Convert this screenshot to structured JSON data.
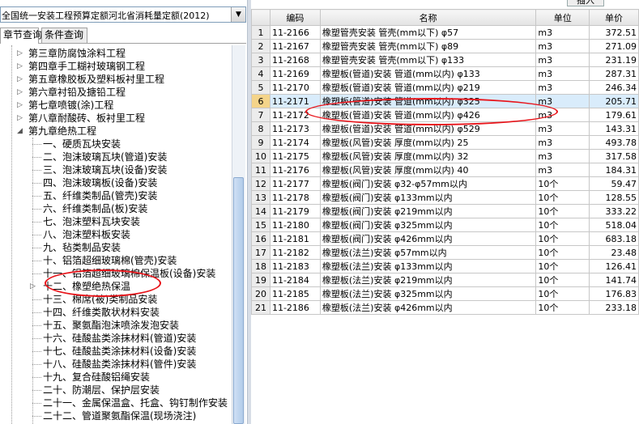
{
  "library_select": {
    "value": "全国统一安装工程预算定额河北省消耗量定额(2012)"
  },
  "tabs": [
    {
      "label": "章节查询"
    },
    {
      "label": "条件查询"
    }
  ],
  "tree": {
    "chapters": [
      {
        "label": "第三章防腐蚀涂料工程"
      },
      {
        "label": "第四章手工糊衬玻璃钢工程"
      },
      {
        "label": "第五章橡胶板及塑料板衬里工程"
      },
      {
        "label": "第六章衬铅及搪铅工程"
      },
      {
        "label": "第七章喷镀(涂)工程"
      },
      {
        "label": "第八章耐酸砖、板衬里工程"
      },
      {
        "label": "第九章绝热工程"
      }
    ],
    "sections": [
      {
        "label": "一、硬质瓦块安装"
      },
      {
        "label": "二、泡沫玻璃瓦块(管道)安装"
      },
      {
        "label": "三、泡沫玻璃瓦块(设备)安装"
      },
      {
        "label": "四、泡沫玻璃板(设备)安装"
      },
      {
        "label": "五、纤维类制品(管壳)安装"
      },
      {
        "label": "六、纤维类制品(板)安装"
      },
      {
        "label": "七、泡沫塑料瓦块安装"
      },
      {
        "label": "八、泡沫塑料板安装"
      },
      {
        "label": "九、毡类制品安装"
      },
      {
        "label": "十、铝箔超细玻璃棉(管壳)安装"
      },
      {
        "label": "十一、铝箔超细玻璃棉保温板(设备)安装"
      },
      {
        "label": "十二、橡塑绝热保温"
      },
      {
        "label": "十三、棉席(被)类制品安装"
      },
      {
        "label": "十四、纤维类散状材料安装"
      },
      {
        "label": "十五、聚氨酯泡沫喷涂发泡安装"
      },
      {
        "label": "十六、硅酸盐类涂抹材料(管道)安装"
      },
      {
        "label": "十七、硅酸盐类涂抹材料(设备)安装"
      },
      {
        "label": "十八、硅酸盐类涂抹材料(管件)安装"
      },
      {
        "label": "十九、复合硅酸铝绳安装"
      },
      {
        "label": "二十、防潮层、保护层安装"
      },
      {
        "label": "二十一、金属保温盒、托盒、钩钉制作安装"
      },
      {
        "label": "二十二、管道聚氨酯保温(现场浇注)"
      }
    ]
  },
  "toolbar": {
    "insert_label": "插入"
  },
  "table": {
    "headers": [
      "编码",
      "名称",
      "单位",
      "单价"
    ],
    "rows": [
      {
        "no": "1",
        "code": "11-2166",
        "name": "橡塑管壳安装 管壳(mm以下) φ57",
        "unit": "m3",
        "price": "372.51"
      },
      {
        "no": "2",
        "code": "11-2167",
        "name": "橡塑管壳安装 管壳(mm以下) φ89",
        "unit": "m3",
        "price": "271.09"
      },
      {
        "no": "3",
        "code": "11-2168",
        "name": "橡塑管壳安装 管壳(mm以下) φ133",
        "unit": "m3",
        "price": "231.19"
      },
      {
        "no": "4",
        "code": "11-2169",
        "name": "橡塑板(管道)安装 管道(mm以内) φ133",
        "unit": "m3",
        "price": "287.31"
      },
      {
        "no": "5",
        "code": "11-2170",
        "name": "橡塑板(管道)安装 管道(mm以内) φ219",
        "unit": "m3",
        "price": "246.34"
      },
      {
        "no": "6",
        "code": "11-2171",
        "name": "橡塑板(管道)安装 管道(mm以内) φ325",
        "unit": "m3",
        "price": "205.71"
      },
      {
        "no": "7",
        "code": "11-2172",
        "name": "橡塑板(管道)安装 管道(mm以内) φ426",
        "unit": "m3",
        "price": "179.61"
      },
      {
        "no": "8",
        "code": "11-2173",
        "name": "橡塑板(管道)安装 管道(mm以内) φ529",
        "unit": "m3",
        "price": "143.31"
      },
      {
        "no": "9",
        "code": "11-2174",
        "name": "橡塑板(风管)安装 厚度(mm以内) 25",
        "unit": "m3",
        "price": "493.78"
      },
      {
        "no": "10",
        "code": "11-2175",
        "name": "橡塑板(风管)安装 厚度(mm以内) 32",
        "unit": "m3",
        "price": "317.58"
      },
      {
        "no": "11",
        "code": "11-2176",
        "name": "橡塑板(风管)安装 厚度(mm以内) 40",
        "unit": "m3",
        "price": "184.31"
      },
      {
        "no": "12",
        "code": "11-2177",
        "name": "橡塑板(阀门)安装 φ32-φ57mm以内",
        "unit": "10个",
        "price": "59.47"
      },
      {
        "no": "13",
        "code": "11-2178",
        "name": "橡塑板(阀门)安装 φ133mm以内",
        "unit": "10个",
        "price": "128.55"
      },
      {
        "no": "14",
        "code": "11-2179",
        "name": "橡塑板(阀门)安装 φ219mm以内",
        "unit": "10个",
        "price": "333.22"
      },
      {
        "no": "15",
        "code": "11-2180",
        "name": "橡塑板(阀门)安装 φ325mm以内",
        "unit": "10个",
        "price": "518.04"
      },
      {
        "no": "16",
        "code": "11-2181",
        "name": "橡塑板(阀门)安装 φ426mm以内",
        "unit": "10个",
        "price": "683.18"
      },
      {
        "no": "17",
        "code": "11-2182",
        "name": "橡塑板(法兰)安装 φ57mm以内",
        "unit": "10个",
        "price": "23.48"
      },
      {
        "no": "18",
        "code": "11-2183",
        "name": "橡塑板(法兰)安装 φ133mm以内",
        "unit": "10个",
        "price": "126.41"
      },
      {
        "no": "19",
        "code": "11-2184",
        "name": "橡塑板(法兰)安装 φ219mm以内",
        "unit": "10个",
        "price": "141.74"
      },
      {
        "no": "20",
        "code": "11-2185",
        "name": "橡塑板(法兰)安装 φ325mm以内",
        "unit": "10个",
        "price": "176.83"
      },
      {
        "no": "21",
        "code": "11-2186",
        "name": "橡塑板(法兰)安装 φ426mm以内",
        "unit": "10个",
        "price": "233.18"
      }
    ]
  },
  "selected_row": "6"
}
